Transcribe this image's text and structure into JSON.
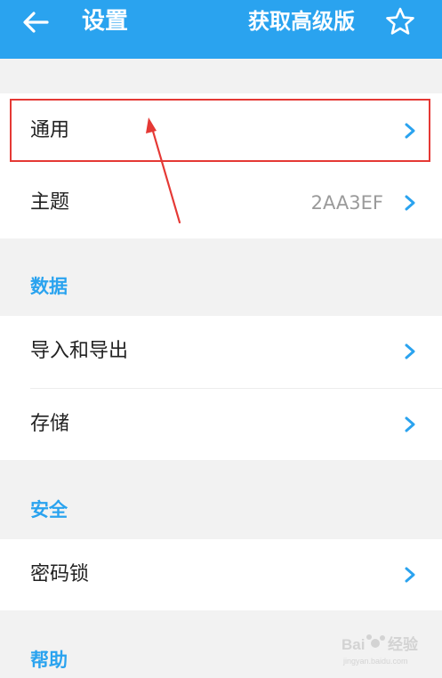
{
  "appbar": {
    "title": "设置",
    "upgrade_label": "获取高级版",
    "back_icon": "arrow-left-icon",
    "star_icon": "star-outline-icon"
  },
  "general": {
    "items": [
      {
        "label": "通用"
      },
      {
        "label": "主题",
        "value": "2AA3EF"
      }
    ]
  },
  "data_section": {
    "header": "数据",
    "items": [
      {
        "label": "导入和导出"
      },
      {
        "label": "存储"
      }
    ]
  },
  "security_section": {
    "header": "安全",
    "items": [
      {
        "label": "密码锁"
      }
    ]
  },
  "help_section": {
    "header": "帮助"
  },
  "colors": {
    "accent": "#2aa3ef",
    "background": "#f2f2f2",
    "card": "#ffffff",
    "annotation": "#e53935"
  },
  "watermark": "Baidu 经验"
}
